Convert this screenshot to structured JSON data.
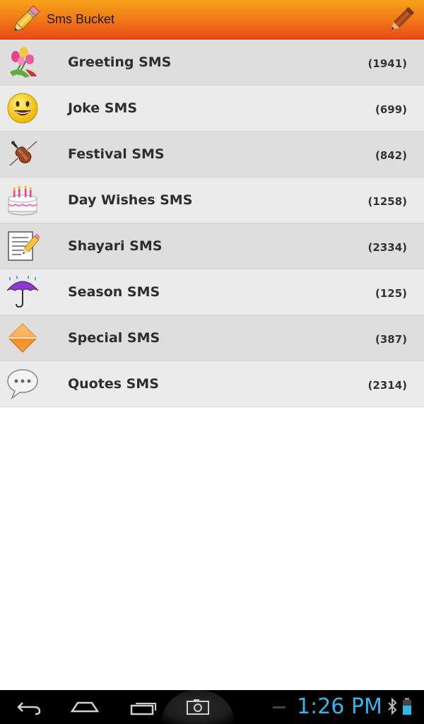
{
  "app": {
    "title": "Sms Bucket"
  },
  "categories": [
    {
      "label": "Greeting SMS",
      "count": "(1941)",
      "icon": "flower-bouquet-icon"
    },
    {
      "label": "Joke SMS",
      "count": "(699)",
      "icon": "smiley-icon"
    },
    {
      "label": "Festival SMS",
      "count": "(842)",
      "icon": "violin-icon"
    },
    {
      "label": "Day Wishes SMS",
      "count": "(1258)",
      "icon": "birthday-cake-icon"
    },
    {
      "label": "Shayari SMS",
      "count": "(2334)",
      "icon": "memo-pencil-icon"
    },
    {
      "label": "Season SMS",
      "count": "(125)",
      "icon": "umbrella-rain-icon"
    },
    {
      "label": "Special SMS",
      "count": "(387)",
      "icon": "orange-diamond-icon"
    },
    {
      "label": "Quotes SMS",
      "count": "(2314)",
      "icon": "speech-bubble-icon"
    }
  ],
  "statusbar": {
    "time": "1:26 PM"
  },
  "colors": {
    "actionbar_top": "#f7a21a",
    "actionbar_bottom": "#e84a16",
    "row_odd": "#dedede",
    "row_even": "#ebebeb",
    "clock": "#33b5e5"
  }
}
